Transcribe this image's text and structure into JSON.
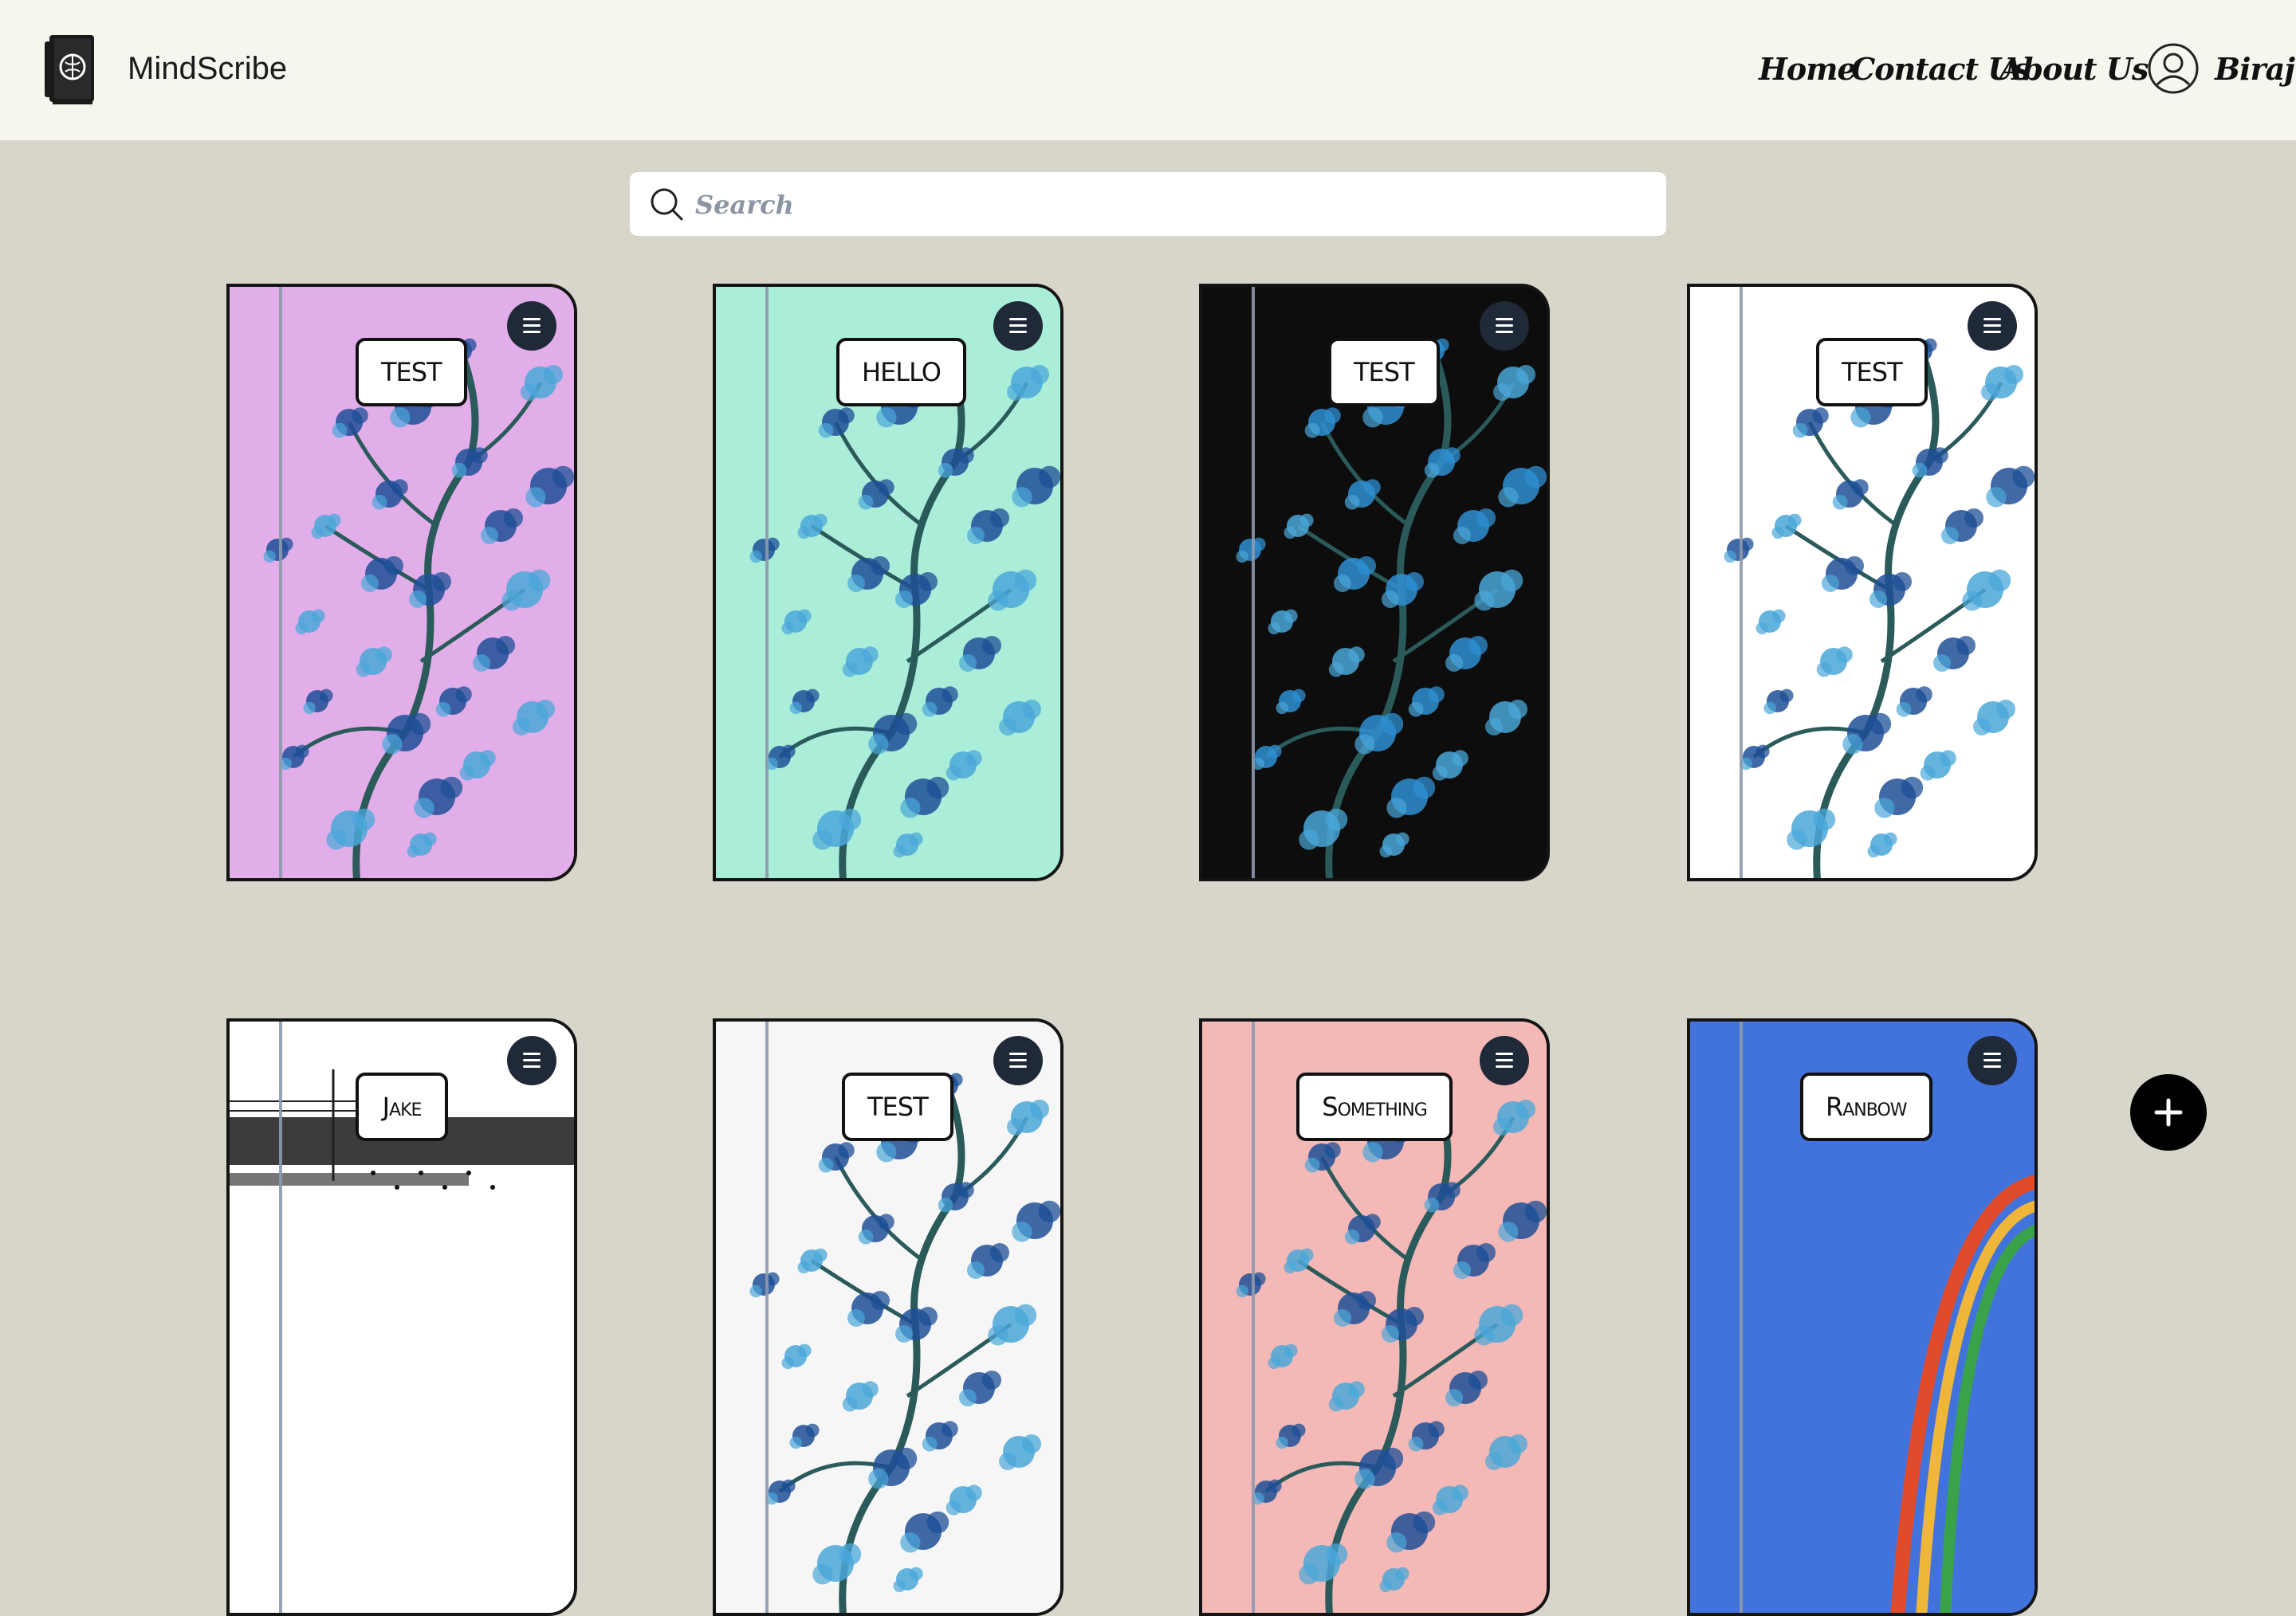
{
  "header": {
    "brand": "MindScribe",
    "nav": [
      "Home",
      "Contact Us",
      "About Us"
    ],
    "user": "Biraj"
  },
  "search": {
    "placeholder": "Search"
  },
  "cards": [
    {
      "title": "TEST",
      "bg": "#e1aee9"
    },
    {
      "title": "HELLO",
      "bg": "#aaeed9"
    },
    {
      "title": "TEST",
      "bg": "#0d0d0d"
    },
    {
      "title": "TEST",
      "bg": "#ffffff"
    },
    {
      "title": "Jake",
      "bg": "#ffffff"
    },
    {
      "title": "TEST",
      "bg": "#f6f6f6"
    },
    {
      "title": "Something",
      "bg": "#f4b8b7"
    },
    {
      "title": "Ranbow",
      "bg": "#4273dd"
    }
  ],
  "colors": {
    "header_bg": "#f6f5ee",
    "page_bg": "#d8d6ca",
    "menu_btn": "#1f2937"
  }
}
